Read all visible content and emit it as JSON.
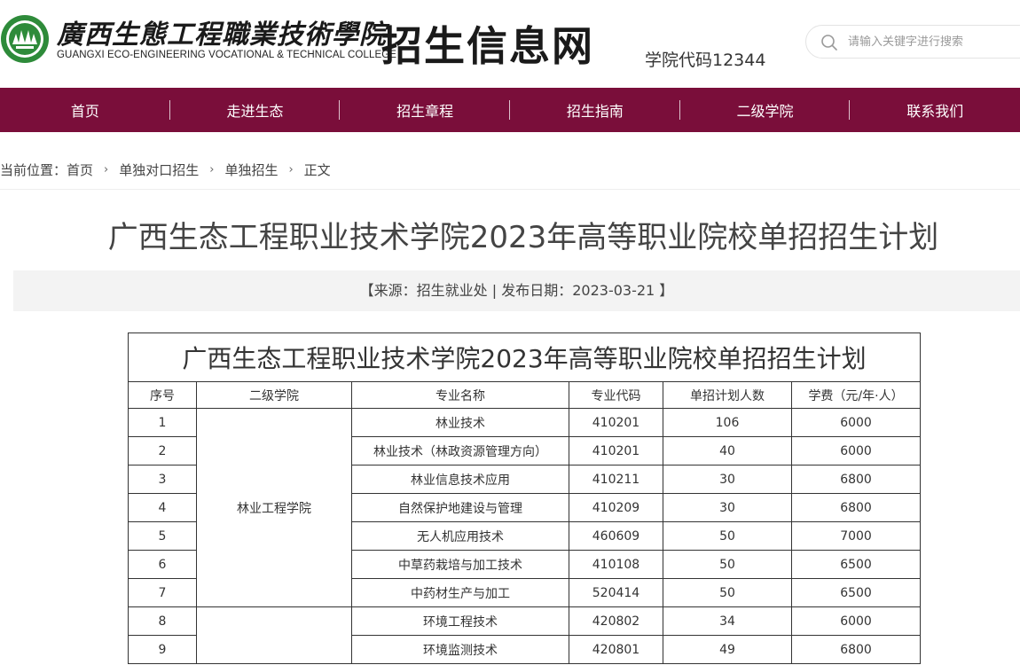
{
  "header": {
    "logo_script": "廣西生態工程職業技術學院",
    "logo_en": "GUANGXI ECO-ENGINEERING VOCATIONAL & TECHNICAL COLLEGE",
    "site_title": "招生信息网",
    "college_code": "学院代码12344",
    "search_placeholder": "请输入关键字进行搜索"
  },
  "nav": {
    "items": [
      "首页",
      "走进生态",
      "招生章程",
      "招生指南",
      "二级学院",
      "联系我们"
    ]
  },
  "breadcrumb": {
    "prefix": "当前位置：",
    "items": [
      "首页",
      "单独对口招生",
      "单独招生",
      "正文"
    ],
    "separator": "›"
  },
  "article": {
    "title": "广西生态工程职业技术学院2023年高等职业院校单招招生计划",
    "meta": "【来源：招生就业处 | 发布日期：2023-03-21 】"
  },
  "table": {
    "caption": "广西生态工程职业技术学院2023年高等职业院校单招招生计划",
    "headers": [
      "序号",
      "二级学院",
      "专业名称",
      "专业代码",
      "单招计划人数",
      "学费（元/年·人）"
    ],
    "groups": [
      {
        "college": "林业工程学院",
        "rows": [
          {
            "no": "1",
            "major": "林业技术",
            "code": "410201",
            "plan": "106",
            "fee": "6000"
          },
          {
            "no": "2",
            "major": "林业技术（林政资源管理方向）",
            "code": "410201",
            "plan": "40",
            "fee": "6000"
          },
          {
            "no": "3",
            "major": "林业信息技术应用",
            "code": "410211",
            "plan": "30",
            "fee": "6800"
          },
          {
            "no": "4",
            "major": "自然保护地建设与管理",
            "code": "410209",
            "plan": "30",
            "fee": "6800"
          },
          {
            "no": "5",
            "major": "无人机应用技术",
            "code": "460609",
            "plan": "50",
            "fee": "7000"
          },
          {
            "no": "6",
            "major": "中草药栽培与加工技术",
            "code": "410108",
            "plan": "50",
            "fee": "6500"
          },
          {
            "no": "7",
            "major": "中药材生产与加工",
            "code": "520414",
            "plan": "50",
            "fee": "6500"
          }
        ]
      },
      {
        "college": "",
        "rows": [
          {
            "no": "8",
            "major": "环境工程技术",
            "code": "420802",
            "plan": "34",
            "fee": "6000"
          },
          {
            "no": "9",
            "major": "环境监测技术",
            "code": "420801",
            "plan": "49",
            "fee": "6800"
          }
        ]
      }
    ]
  },
  "colors": {
    "nav_bg": "#7a0e3a",
    "logo_green": "#2e8b3a"
  }
}
